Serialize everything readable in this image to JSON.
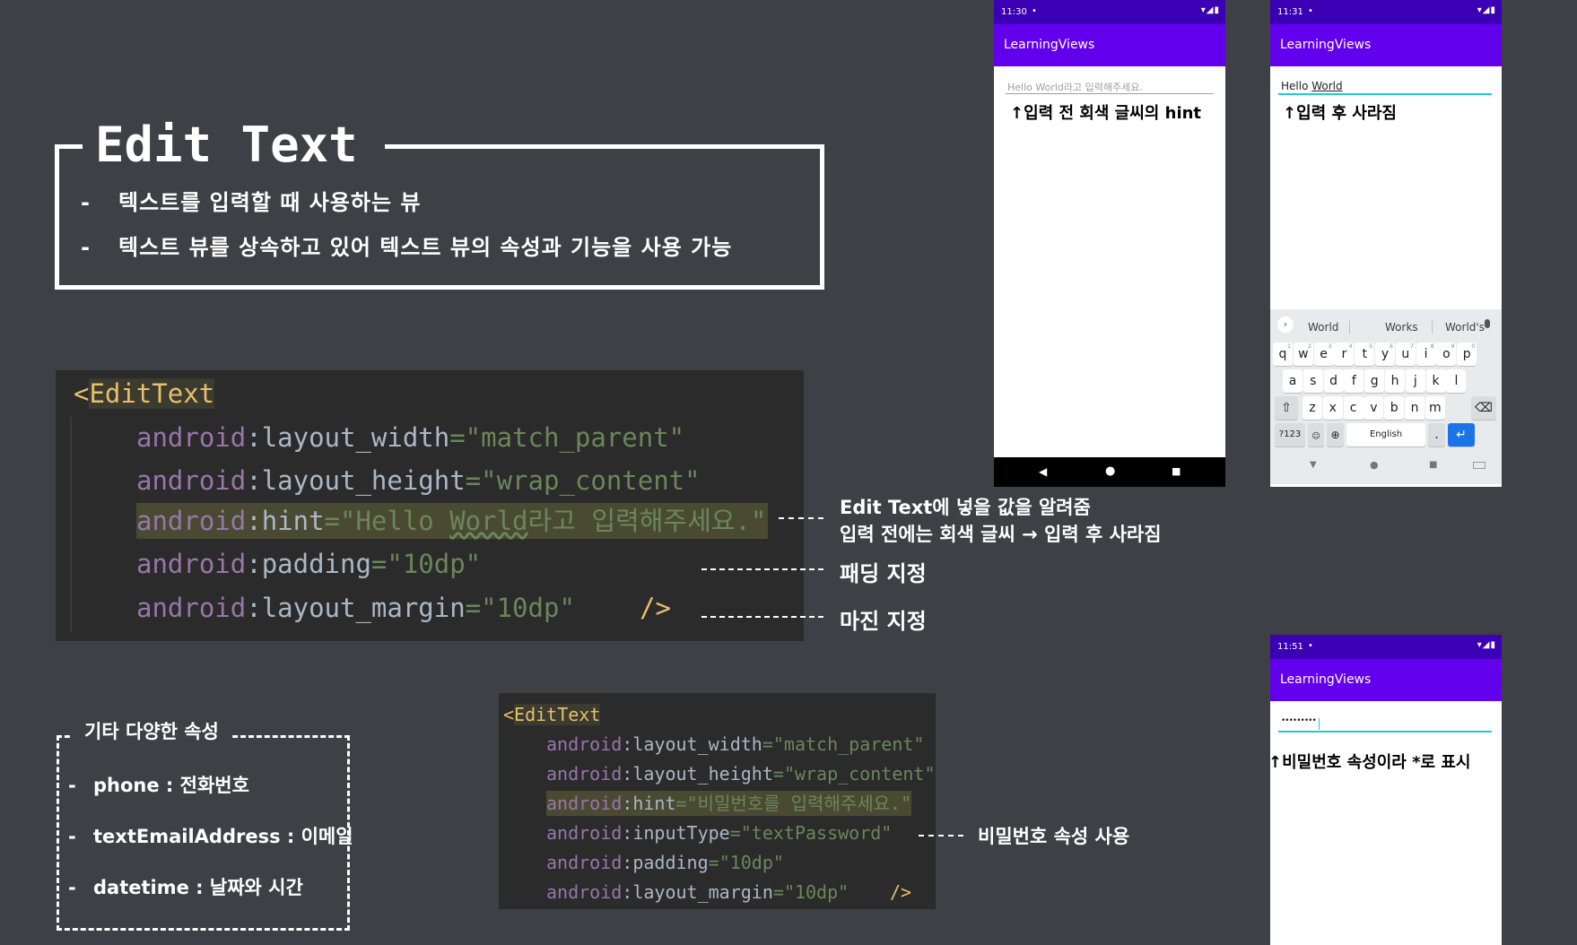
{
  "title": "Edit Text",
  "bullets": [
    "텍스트를 입력할 때 사용하는 뷰",
    "텍스트 뷰를 상속하고 있어 텍스트 뷰의 속성과 기능을 사용 가능"
  ],
  "dash": "-",
  "code1": {
    "open_bracket": "<",
    "tag": "EditText",
    "lines": [
      {
        "attr": "android",
        "colon": ":",
        "name": "layout_width",
        "eq": "=",
        "value": "\"match_parent\""
      },
      {
        "attr": "android",
        "colon": ":",
        "name": "layout_height",
        "eq": "=",
        "value": "\"wrap_content\""
      },
      {
        "attr": "android",
        "colon": ":",
        "name": "hint",
        "eq": "=",
        "value_a": "\"Hello ",
        "value_b": "World",
        "value_c": "라고 입력해주세요.\""
      },
      {
        "attr": "android",
        "colon": ":",
        "name": "padding",
        "eq": "=",
        "value": "\"10dp\""
      },
      {
        "attr": "android",
        "colon": ":",
        "name": "layout_margin",
        "eq": "=",
        "value": "\"10dp\""
      }
    ],
    "close": "/>"
  },
  "notes": {
    "hint_1": "Edit Text에 넣을 값을 알려줌",
    "hint_2": "입력 전에는 회색 글씨 → 입력 후 사라짐",
    "padding": "패딩 지정",
    "margin": "마진 지정",
    "password": "비밀번호 속성 사용"
  },
  "etc": {
    "title": "기타 다양한 속성",
    "items": [
      {
        "key": "phone",
        "sep": " : ",
        "desc": "전화번호"
      },
      {
        "key": "textEmailAddress",
        "sep": " : ",
        "desc": "이메일"
      },
      {
        "key": "datetime",
        "sep": " : ",
        "desc": "날짜와 시간"
      }
    ]
  },
  "code2": {
    "open_bracket": "<",
    "tag": "EditText",
    "lines": [
      {
        "attr": "android",
        "colon": ":",
        "name": "layout_width",
        "eq": "=",
        "value": "\"match_parent\""
      },
      {
        "attr": "android",
        "colon": ":",
        "name": "layout_height",
        "eq": "=",
        "value": "\"wrap_content\""
      },
      {
        "attr": "android",
        "colon": ":",
        "name": "hint",
        "eq": "=",
        "value": "\"비밀번호를 입력해주세요.\""
      },
      {
        "attr": "android",
        "colon": ":",
        "name": "inputType",
        "eq": "=",
        "value": "\"textPassword\""
      },
      {
        "attr": "android",
        "colon": ":",
        "name": "padding",
        "eq": "=",
        "value": "\"10dp\""
      },
      {
        "attr": "android",
        "colon": ":",
        "name": "layout_margin",
        "eq": "=",
        "value": "\"10dp\""
      }
    ],
    "close": "/>"
  },
  "phone1": {
    "time": "11:30",
    "dot": "•",
    "status_icons": "▾◢▮",
    "app_title": "LearningViews",
    "hint": "Hello World라고 입력해주세요.",
    "note": "↑입력 전 회색 글씨의 hint",
    "nav_back": "◀",
    "nav_home": "●",
    "nav_recent": "■"
  },
  "phone2": {
    "time": "11:31",
    "dot": "•",
    "status_icons": "▾◢▮",
    "app_title": "LearningViews",
    "text_a": "Hello ",
    "text_b": "World",
    "note": "↑입력 후 사라짐",
    "suggestions": [
      "World",
      "Works",
      "World's"
    ],
    "row1": [
      "q",
      "w",
      "e",
      "r",
      "t",
      "y",
      "u",
      "i",
      "o",
      "p"
    ],
    "row1_nums": [
      "1",
      "2",
      "3",
      "4",
      "5",
      "6",
      "7",
      "8",
      "9",
      "0"
    ],
    "row2": [
      "a",
      "s",
      "d",
      "f",
      "g",
      "h",
      "j",
      "k",
      "l"
    ],
    "row3": [
      "z",
      "x",
      "c",
      "v",
      "b",
      "n",
      "m"
    ],
    "sym_key": "?123",
    "space_label": "English",
    "period": ".",
    "nav_back": "▼",
    "nav_home": "●",
    "nav_recent": "■"
  },
  "phone3": {
    "time": "11:51",
    "dot": "•",
    "status_icons": "▾◢▮",
    "app_title": "LearningViews",
    "password": "•••••••••",
    "note": "↑비밀번호 속성이라 *로 표시"
  }
}
